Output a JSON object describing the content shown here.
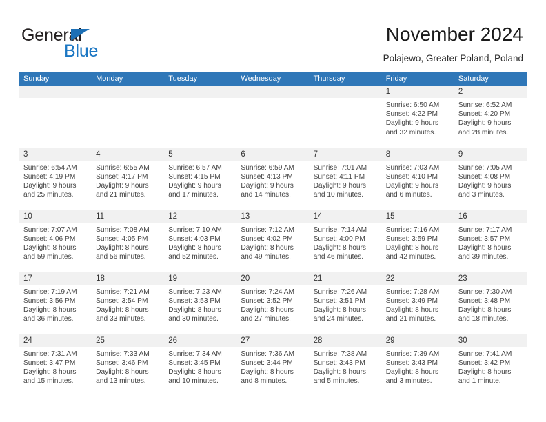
{
  "brand": {
    "word1": "General",
    "word2": "Blue",
    "triangle_color": "#1c6fb5",
    "blue_color": "#1c77c3"
  },
  "header": {
    "title": "November 2024",
    "subtitle": "Polajewo, Greater Poland, Poland"
  },
  "colors": {
    "header_blue": "#2f77b8",
    "daynum_band": "#f1f1f1",
    "text": "#444444"
  },
  "calendar": {
    "weekday_headers": [
      "Sunday",
      "Monday",
      "Tuesday",
      "Wednesday",
      "Thursday",
      "Friday",
      "Saturday"
    ],
    "weeks": [
      [
        {
          "day": "",
          "lines": []
        },
        {
          "day": "",
          "lines": []
        },
        {
          "day": "",
          "lines": []
        },
        {
          "day": "",
          "lines": []
        },
        {
          "day": "",
          "lines": []
        },
        {
          "day": "1",
          "lines": [
            "Sunrise: 6:50 AM",
            "Sunset: 4:22 PM",
            "Daylight: 9 hours",
            "and 32 minutes."
          ]
        },
        {
          "day": "2",
          "lines": [
            "Sunrise: 6:52 AM",
            "Sunset: 4:20 PM",
            "Daylight: 9 hours",
            "and 28 minutes."
          ]
        }
      ],
      [
        {
          "day": "3",
          "lines": [
            "Sunrise: 6:54 AM",
            "Sunset: 4:19 PM",
            "Daylight: 9 hours",
            "and 25 minutes."
          ]
        },
        {
          "day": "4",
          "lines": [
            "Sunrise: 6:55 AM",
            "Sunset: 4:17 PM",
            "Daylight: 9 hours",
            "and 21 minutes."
          ]
        },
        {
          "day": "5",
          "lines": [
            "Sunrise: 6:57 AM",
            "Sunset: 4:15 PM",
            "Daylight: 9 hours",
            "and 17 minutes."
          ]
        },
        {
          "day": "6",
          "lines": [
            "Sunrise: 6:59 AM",
            "Sunset: 4:13 PM",
            "Daylight: 9 hours",
            "and 14 minutes."
          ]
        },
        {
          "day": "7",
          "lines": [
            "Sunrise: 7:01 AM",
            "Sunset: 4:11 PM",
            "Daylight: 9 hours",
            "and 10 minutes."
          ]
        },
        {
          "day": "8",
          "lines": [
            "Sunrise: 7:03 AM",
            "Sunset: 4:10 PM",
            "Daylight: 9 hours",
            "and 6 minutes."
          ]
        },
        {
          "day": "9",
          "lines": [
            "Sunrise: 7:05 AM",
            "Sunset: 4:08 PM",
            "Daylight: 9 hours",
            "and 3 minutes."
          ]
        }
      ],
      [
        {
          "day": "10",
          "lines": [
            "Sunrise: 7:07 AM",
            "Sunset: 4:06 PM",
            "Daylight: 8 hours",
            "and 59 minutes."
          ]
        },
        {
          "day": "11",
          "lines": [
            "Sunrise: 7:08 AM",
            "Sunset: 4:05 PM",
            "Daylight: 8 hours",
            "and 56 minutes."
          ]
        },
        {
          "day": "12",
          "lines": [
            "Sunrise: 7:10 AM",
            "Sunset: 4:03 PM",
            "Daylight: 8 hours",
            "and 52 minutes."
          ]
        },
        {
          "day": "13",
          "lines": [
            "Sunrise: 7:12 AM",
            "Sunset: 4:02 PM",
            "Daylight: 8 hours",
            "and 49 minutes."
          ]
        },
        {
          "day": "14",
          "lines": [
            "Sunrise: 7:14 AM",
            "Sunset: 4:00 PM",
            "Daylight: 8 hours",
            "and 46 minutes."
          ]
        },
        {
          "day": "15",
          "lines": [
            "Sunrise: 7:16 AM",
            "Sunset: 3:59 PM",
            "Daylight: 8 hours",
            "and 42 minutes."
          ]
        },
        {
          "day": "16",
          "lines": [
            "Sunrise: 7:17 AM",
            "Sunset: 3:57 PM",
            "Daylight: 8 hours",
            "and 39 minutes."
          ]
        }
      ],
      [
        {
          "day": "17",
          "lines": [
            "Sunrise: 7:19 AM",
            "Sunset: 3:56 PM",
            "Daylight: 8 hours",
            "and 36 minutes."
          ]
        },
        {
          "day": "18",
          "lines": [
            "Sunrise: 7:21 AM",
            "Sunset: 3:54 PM",
            "Daylight: 8 hours",
            "and 33 minutes."
          ]
        },
        {
          "day": "19",
          "lines": [
            "Sunrise: 7:23 AM",
            "Sunset: 3:53 PM",
            "Daylight: 8 hours",
            "and 30 minutes."
          ]
        },
        {
          "day": "20",
          "lines": [
            "Sunrise: 7:24 AM",
            "Sunset: 3:52 PM",
            "Daylight: 8 hours",
            "and 27 minutes."
          ]
        },
        {
          "day": "21",
          "lines": [
            "Sunrise: 7:26 AM",
            "Sunset: 3:51 PM",
            "Daylight: 8 hours",
            "and 24 minutes."
          ]
        },
        {
          "day": "22",
          "lines": [
            "Sunrise: 7:28 AM",
            "Sunset: 3:49 PM",
            "Daylight: 8 hours",
            "and 21 minutes."
          ]
        },
        {
          "day": "23",
          "lines": [
            "Sunrise: 7:30 AM",
            "Sunset: 3:48 PM",
            "Daylight: 8 hours",
            "and 18 minutes."
          ]
        }
      ],
      [
        {
          "day": "24",
          "lines": [
            "Sunrise: 7:31 AM",
            "Sunset: 3:47 PM",
            "Daylight: 8 hours",
            "and 15 minutes."
          ]
        },
        {
          "day": "25",
          "lines": [
            "Sunrise: 7:33 AM",
            "Sunset: 3:46 PM",
            "Daylight: 8 hours",
            "and 13 minutes."
          ]
        },
        {
          "day": "26",
          "lines": [
            "Sunrise: 7:34 AM",
            "Sunset: 3:45 PM",
            "Daylight: 8 hours",
            "and 10 minutes."
          ]
        },
        {
          "day": "27",
          "lines": [
            "Sunrise: 7:36 AM",
            "Sunset: 3:44 PM",
            "Daylight: 8 hours",
            "and 8 minutes."
          ]
        },
        {
          "day": "28",
          "lines": [
            "Sunrise: 7:38 AM",
            "Sunset: 3:43 PM",
            "Daylight: 8 hours",
            "and 5 minutes."
          ]
        },
        {
          "day": "29",
          "lines": [
            "Sunrise: 7:39 AM",
            "Sunset: 3:43 PM",
            "Daylight: 8 hours",
            "and 3 minutes."
          ]
        },
        {
          "day": "30",
          "lines": [
            "Sunrise: 7:41 AM",
            "Sunset: 3:42 PM",
            "Daylight: 8 hours",
            "and 1 minute."
          ]
        }
      ]
    ]
  }
}
